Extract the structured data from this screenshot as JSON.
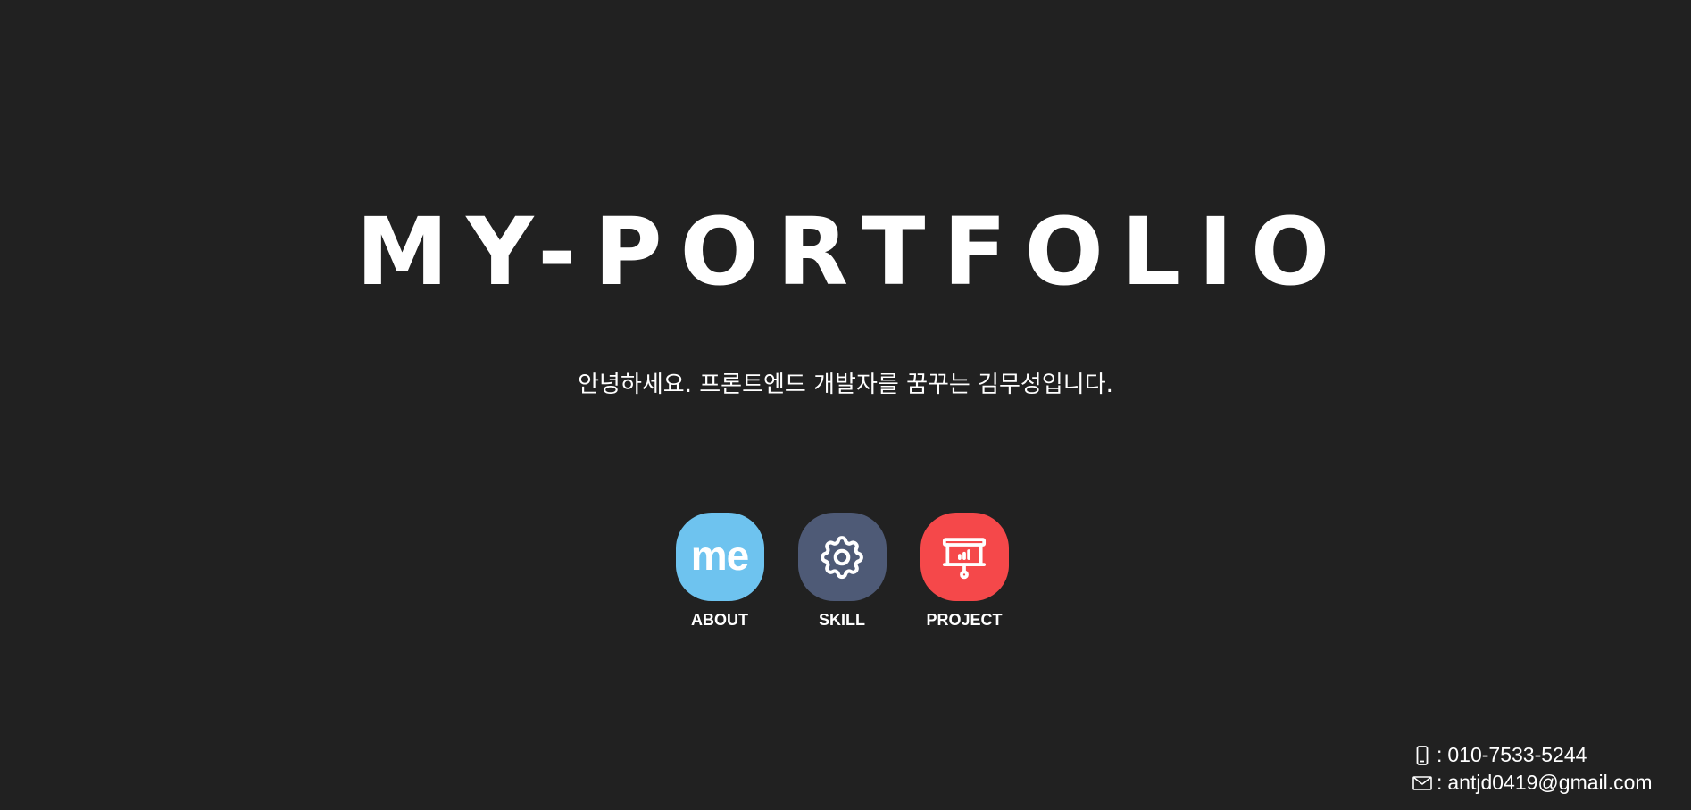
{
  "hero": {
    "title": "MY-PORTFOLIO",
    "subtitle": "안녕하세요. 프론트엔드 개발자를 꿈꾸는 김무성입니다."
  },
  "apps": [
    {
      "label": "ABOUT",
      "glyph": "me",
      "icon": "me-icon",
      "color": "#6ec3ef"
    },
    {
      "label": "SKILL",
      "icon": "gear-icon",
      "color": "#4e5a76"
    },
    {
      "label": "PROJECT",
      "icon": "presentation-board-icon",
      "color": "#f5484a"
    }
  ],
  "contact": {
    "phone": {
      "icon": "mobile-phone-icon",
      "separator": ":",
      "value": "010-7533-5244"
    },
    "email": {
      "icon": "envelope-icon",
      "separator": ":",
      "value": "antjd0419@gmail.com"
    }
  },
  "colors": {
    "background": "#212121",
    "text": "#ffffff"
  }
}
